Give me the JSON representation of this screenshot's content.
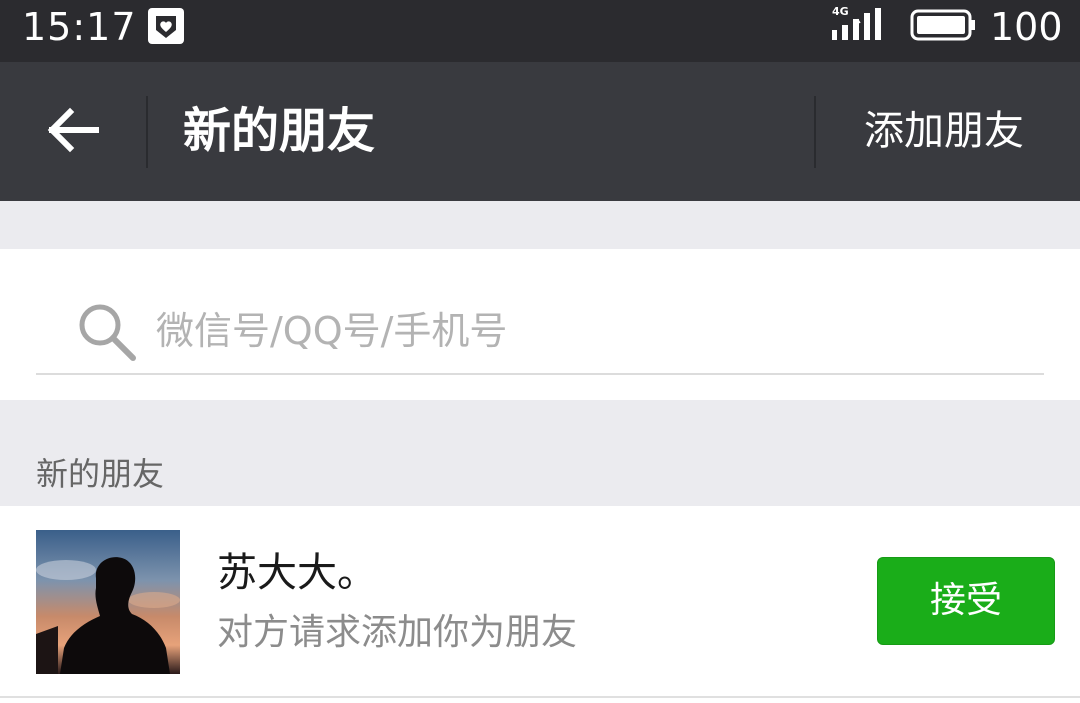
{
  "status_bar": {
    "time": "15:17",
    "app_icon": "heart-notification-icon",
    "network": "4G",
    "signal_icon": "signal-icon",
    "battery_icon": "battery-icon",
    "battery_percent": "100",
    "battery_level": 1.0
  },
  "header": {
    "back_icon": "back-arrow-icon",
    "title": "新的朋友",
    "add_friend_label": "添加朋友"
  },
  "search": {
    "icon": "search-icon",
    "placeholder": "微信号/QQ号/手机号",
    "value": ""
  },
  "section": {
    "title": "新的朋友"
  },
  "requests": [
    {
      "avatar": "avatar-silhouette-sunset",
      "name": "苏大大。",
      "message": "对方请求添加你为朋友",
      "accept_label": "接受"
    }
  ],
  "colors": {
    "status_bar_bg": "#2b2b2f",
    "title_bar_bg": "#393a3f",
    "page_gray": "#ebebef",
    "accept_green": "#1aad19"
  }
}
